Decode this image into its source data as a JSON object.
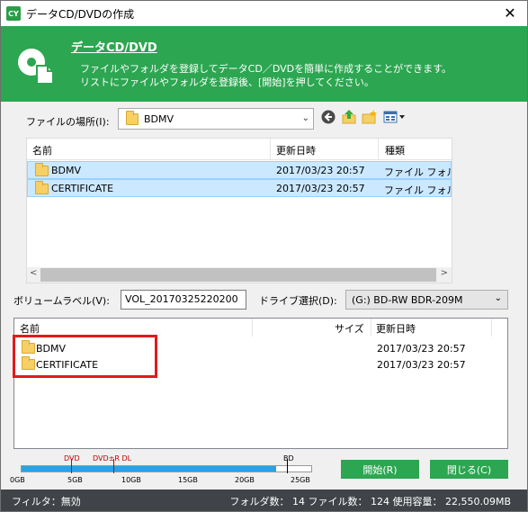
{
  "window": {
    "app_badge": "CY",
    "title": "データCD/DVDの作成",
    "close": "✕"
  },
  "header": {
    "title": "データCD/DVD",
    "desc_line1": "ファイルやフォルダを登録してデータCD／DVDを簡単に作成することができます。",
    "desc_line2": "リストにファイルやフォルダを登録後、[開始]を押してください。"
  },
  "location": {
    "label": "ファイルの場所(I):",
    "value": "BDMV"
  },
  "file_list": {
    "columns": [
      "名前",
      "更新日時",
      "種類"
    ],
    "rows": [
      {
        "name": "BDMV",
        "date": "2017/03/23 20:57",
        "type": "ファイル フォルダー"
      },
      {
        "name": "CERTIFICATE",
        "date": "2017/03/23 20:57",
        "type": "ファイル フォルダー"
      }
    ]
  },
  "volume": {
    "label": "ボリュームラベル(V):",
    "value": "VOL_20170325220200"
  },
  "drive": {
    "label": "ドライブ選択(D):",
    "value": "(G:) BD-RW   BDR-209M"
  },
  "registered_list": {
    "columns": [
      "名前",
      "サイズ",
      "更新日時"
    ],
    "rows": [
      {
        "name": "BDMV",
        "size": "",
        "date": "2017/03/23 20:57"
      },
      {
        "name": "CERTIFICATE",
        "size": "",
        "date": "2017/03/23 20:57"
      }
    ]
  },
  "capacity": {
    "marks": {
      "dvd": "DVD",
      "dvd_dl": "DVD±R DL",
      "bd": "BD"
    },
    "ticks": [
      "0GB",
      "5GB",
      "10GB",
      "15GB",
      "20GB",
      "25GB"
    ],
    "used_fraction": 0.88,
    "fill_color": "#29a3e6"
  },
  "buttons": {
    "start": "開始(R)",
    "close": "閉じる(C)"
  },
  "status": {
    "filter": "フィルタ：無効",
    "summary": "フォルダ数： 14  ファイル数： 124  使用容量： 22,550.09MB"
  },
  "colors": {
    "accent": "#2da651",
    "highlight": "#e21a1a",
    "selection": "#cce8ff"
  }
}
